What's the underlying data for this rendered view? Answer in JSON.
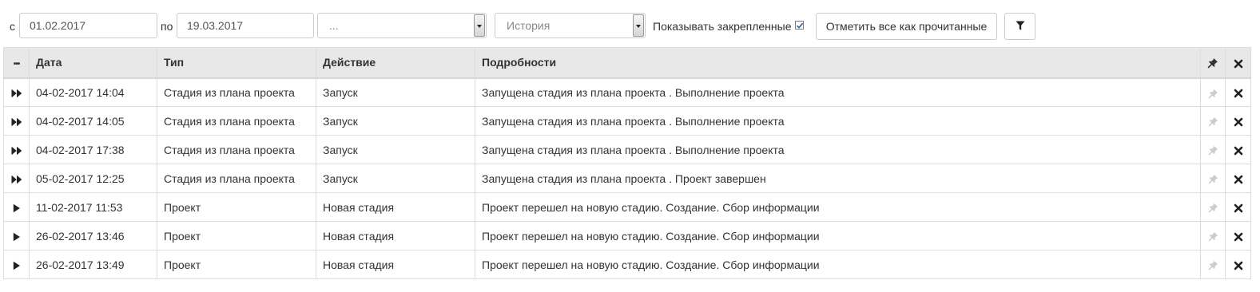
{
  "filters": {
    "from_label": "с",
    "from_value": "01.02.2017",
    "to_label": "по",
    "to_value": "19.03.2017",
    "select1_value": "...",
    "select2_value": "История",
    "show_pinned_label": "Показывать закрепленные",
    "show_pinned_checked": true,
    "mark_all_read_label": "Отметить все как прочитанные"
  },
  "table": {
    "columns": {
      "menu": "•••",
      "date": "Дата",
      "type": "Тип",
      "action": "Действие",
      "details": "Подробности"
    },
    "rows": [
      {
        "icon": "fast-forward-icon",
        "date": "04-02-2017 14:04",
        "type": "Стадия из плана проекта",
        "action": "Запуск",
        "details": "Запущена стадия из плана проекта . Выполнение проекта"
      },
      {
        "icon": "fast-forward-icon",
        "date": "04-02-2017 14:05",
        "type": "Стадия из плана проекта",
        "action": "Запуск",
        "details": "Запущена стадия из плана проекта . Выполнение проекта"
      },
      {
        "icon": "fast-forward-icon",
        "date": "04-02-2017 17:38",
        "type": "Стадия из плана проекта",
        "action": "Запуск",
        "details": "Запущена стадия из плана проекта . Выполнение проекта"
      },
      {
        "icon": "fast-forward-icon",
        "date": "05-02-2017 12:25",
        "type": "Стадия из плана проекта",
        "action": "Запуск",
        "details": "Запущена стадия из плана проекта . Проект завершен"
      },
      {
        "icon": "play-icon",
        "date": "11-02-2017 11:53",
        "type": "Проект",
        "action": "Новая стадия",
        "details": "Проект перешел на новую стадию. Создание. Сбор информации"
      },
      {
        "icon": "play-icon",
        "date": "26-02-2017 13:46",
        "type": "Проект",
        "action": "Новая стадия",
        "details": "Проект перешел на новую стадию. Создание. Сбор информации"
      },
      {
        "icon": "play-icon",
        "date": "26-02-2017 13:49",
        "type": "Проект",
        "action": "Новая стадия",
        "details": "Проект перешел на новую стадию. Создание. Сбор информации"
      }
    ]
  },
  "colors": {
    "header_bg": "#e8e8e8",
    "border": "#dddddd",
    "pin_inactive": "#c8c8c8",
    "icon_dark": "#222222"
  }
}
